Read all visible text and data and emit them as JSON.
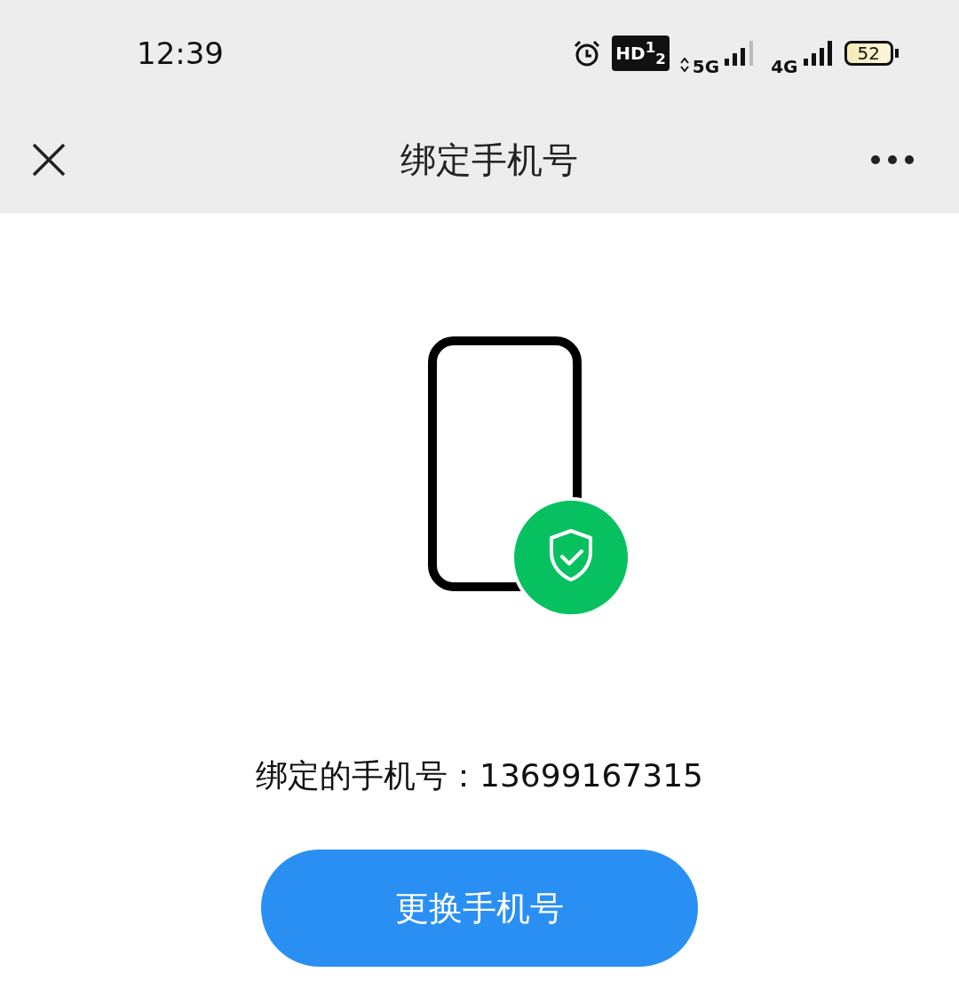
{
  "status_bar": {
    "time": "12:39",
    "hd_badge": "HD$^{1}$$_{2}$",
    "network_1": "5G",
    "network_2": "4G",
    "battery": "52"
  },
  "nav_bar": {
    "title": "绑定手机号"
  },
  "bound_phone": {
    "label": "绑定的手机号：",
    "number": "13699167315"
  },
  "buttons": [
    {
      "label": "更换手机号",
      "kind": "primary"
    }
  ]
}
